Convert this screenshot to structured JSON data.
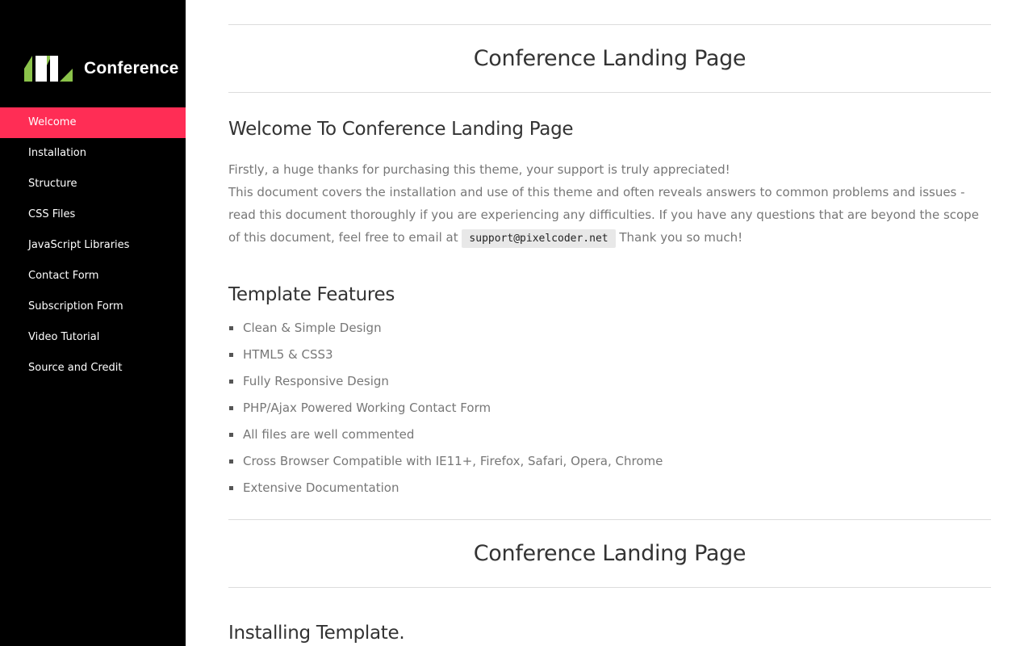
{
  "sidebar": {
    "logo_text": "Conference",
    "colors": {
      "background": "#000000",
      "active": "#ff2d55",
      "logo_green": "#8bc34a"
    },
    "items": [
      {
        "label": "Welcome",
        "active": true
      },
      {
        "label": "Installation"
      },
      {
        "label": "Structure"
      },
      {
        "label": "CSS Files"
      },
      {
        "label": "JavaScript Libraries"
      },
      {
        "label": "Contact Form"
      },
      {
        "label": "Subscription Form"
      },
      {
        "label": "Video Tutorial"
      },
      {
        "label": "Source and Credit"
      }
    ]
  },
  "main": {
    "page_title": "Conference Landing Page",
    "welcome": {
      "heading": "Welcome To Conference Landing Page",
      "line1": "Firstly, a huge thanks for purchasing this theme, your support is truly appreciated!",
      "line2": "This document covers the installation and use of this theme and often reveals answers to common problems and issues - read this document thoroughly if you are experiencing any difficulties. If you have any questions that are beyond the scope of this document, feel free to email at",
      "email": "support@pixelcoder.net",
      "line3": "Thank you so much!"
    },
    "features": {
      "heading": "Template Features",
      "items": [
        "Clean & Simple Design",
        "HTML5 & CSS3",
        "Fully Responsive Design",
        "PHP/Ajax Powered Working Contact Form",
        "All files are well commented",
        "Cross Browser Compatible with IE11+, Firefox, Safari, Opera, Chrome",
        "Extensive Documentation"
      ]
    },
    "page_title_2": "Conference Landing Page",
    "installing": {
      "heading": "Installing Template."
    }
  }
}
